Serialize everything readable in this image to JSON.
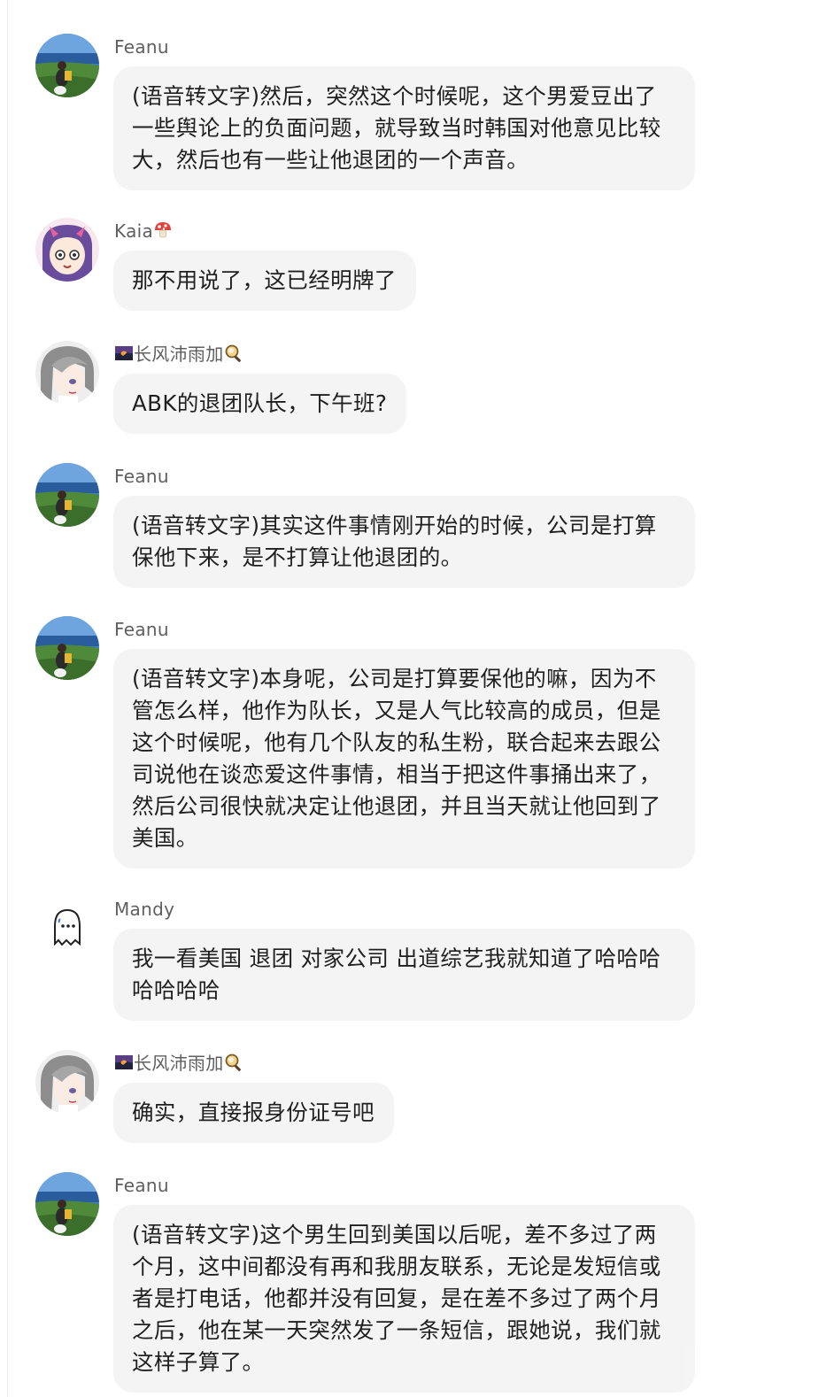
{
  "messages": [
    {
      "sender": "Feanu",
      "avatar_icon": "landscape-avatar-icon",
      "name_emoji": [],
      "text": "(语音转文字)然后，突然这个时候呢，这个男爱豆出了一些舆论上的负面问题，就导致当时韩国对他意见比较大，然后也有一些让他退团的一个声音。"
    },
    {
      "sender": "Kaia",
      "avatar_icon": "anime-girl-avatar-icon",
      "name_emoji": [
        "mushroom-icon"
      ],
      "text": "那不用说了，这已经明牌了"
    },
    {
      "sender": "长风沛雨加",
      "avatar_icon": "silver-hair-avatar-icon",
      "name_emoji": [
        "sunset-photo-icon",
        "magnifier-icon"
      ],
      "text": "ABK的退团队长，下午班?"
    },
    {
      "sender": "Feanu",
      "avatar_icon": "landscape-avatar-icon",
      "name_emoji": [],
      "text": "(语音转文字)其实这件事情刚开始的时候，公司是打算保他下来，是不打算让他退团的。"
    },
    {
      "sender": "Feanu",
      "avatar_icon": "landscape-avatar-icon",
      "name_emoji": [],
      "text": "(语音转文字)本身呢，公司是打算要保他的嘛，因为不管怎么样，他作为队长，又是人气比较高的成员，但是这个时候呢，他有几个队友的私生粉，联合起来去跟公司说他在谈恋爱这件事情，相当于把这件事捅出来了，然后公司很快就决定让他退团，并且当天就让他回到了美国。"
    },
    {
      "sender": "Mandy",
      "avatar_icon": "ghost-avatar-icon",
      "name_emoji": [],
      "text": "我一看美国 退团 对家公司 出道综艺我就知道了哈哈哈哈哈哈哈"
    },
    {
      "sender": "长风沛雨加",
      "avatar_icon": "silver-hair-avatar-icon",
      "name_emoji": [
        "sunset-photo-icon",
        "magnifier-icon"
      ],
      "text": "确实，直接报身份证号吧"
    },
    {
      "sender": "Feanu",
      "avatar_icon": "landscape-avatar-icon",
      "name_emoji": [],
      "text": "(语音转文字)这个男生回到美国以后呢，差不多过了两个月，这中间都没有再和我朋友联系，无论是发短信或者是打电话，他都并没有回复，是在差不多过了两个月之后，他在某一天突然发了一条短信，跟她说，我们就这样子算了。"
    }
  ]
}
